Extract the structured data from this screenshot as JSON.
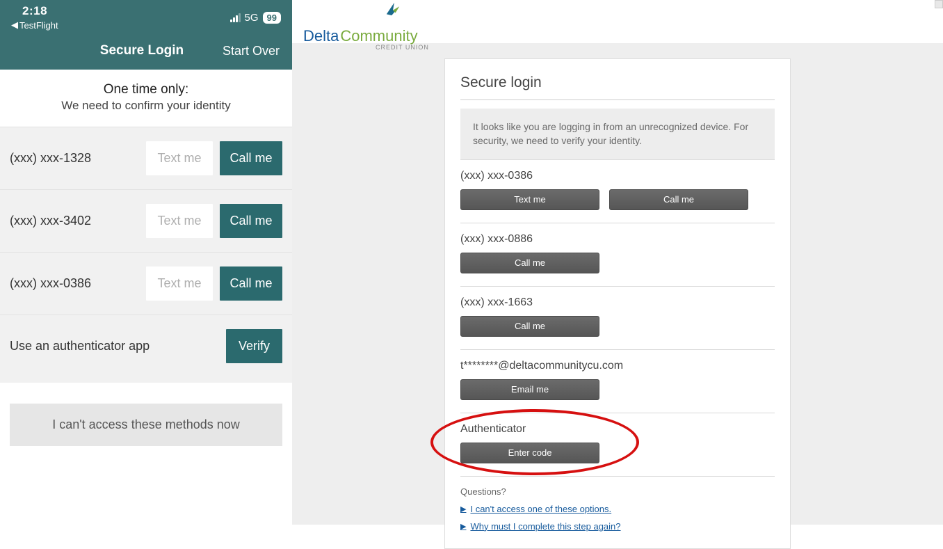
{
  "mobile": {
    "status": {
      "time": "2:18",
      "back_app": "TestFlight",
      "network": "5G",
      "battery": "99"
    },
    "header": {
      "title": "Secure Login",
      "start_over": "Start Over"
    },
    "one_time": {
      "title": "One time only:",
      "sub": "We need to confirm your identity"
    },
    "methods": [
      {
        "label": "(xxx) xxx-1328",
        "text_btn": "Text me",
        "call_btn": "Call me"
      },
      {
        "label": "(xxx) xxx-3402",
        "text_btn": "Text me",
        "call_btn": "Call me"
      },
      {
        "label": "(xxx) xxx-0386",
        "text_btn": "Text me",
        "call_btn": "Call me"
      }
    ],
    "auth": {
      "label": "Use an authenticator app",
      "button": "Verify"
    },
    "cant_access": "I can't access these methods now"
  },
  "desktop": {
    "logo": {
      "part1": "Delta",
      "part2": "Community",
      "sub": "CREDIT UNION"
    },
    "card": {
      "title": "Secure login",
      "info": "It looks like you are logging in from an unrecognized device. For security, we need to verify your identity.",
      "methods": [
        {
          "label": "(xxx) xxx-0386",
          "buttons": [
            "Text me",
            "Call me"
          ]
        },
        {
          "label": "(xxx) xxx-0886",
          "buttons": [
            "Call me"
          ]
        },
        {
          "label": "(xxx) xxx-1663",
          "buttons": [
            "Call me"
          ]
        },
        {
          "label": "t********@deltacommunitycu.com",
          "buttons": [
            "Email me"
          ]
        },
        {
          "label": "Authenticator",
          "buttons": [
            "Enter code"
          ],
          "annotated": true
        }
      ],
      "questions": {
        "title": "Questions?",
        "links": [
          "I can't access one of these options.",
          "Why must I complete this step again?"
        ]
      }
    }
  }
}
